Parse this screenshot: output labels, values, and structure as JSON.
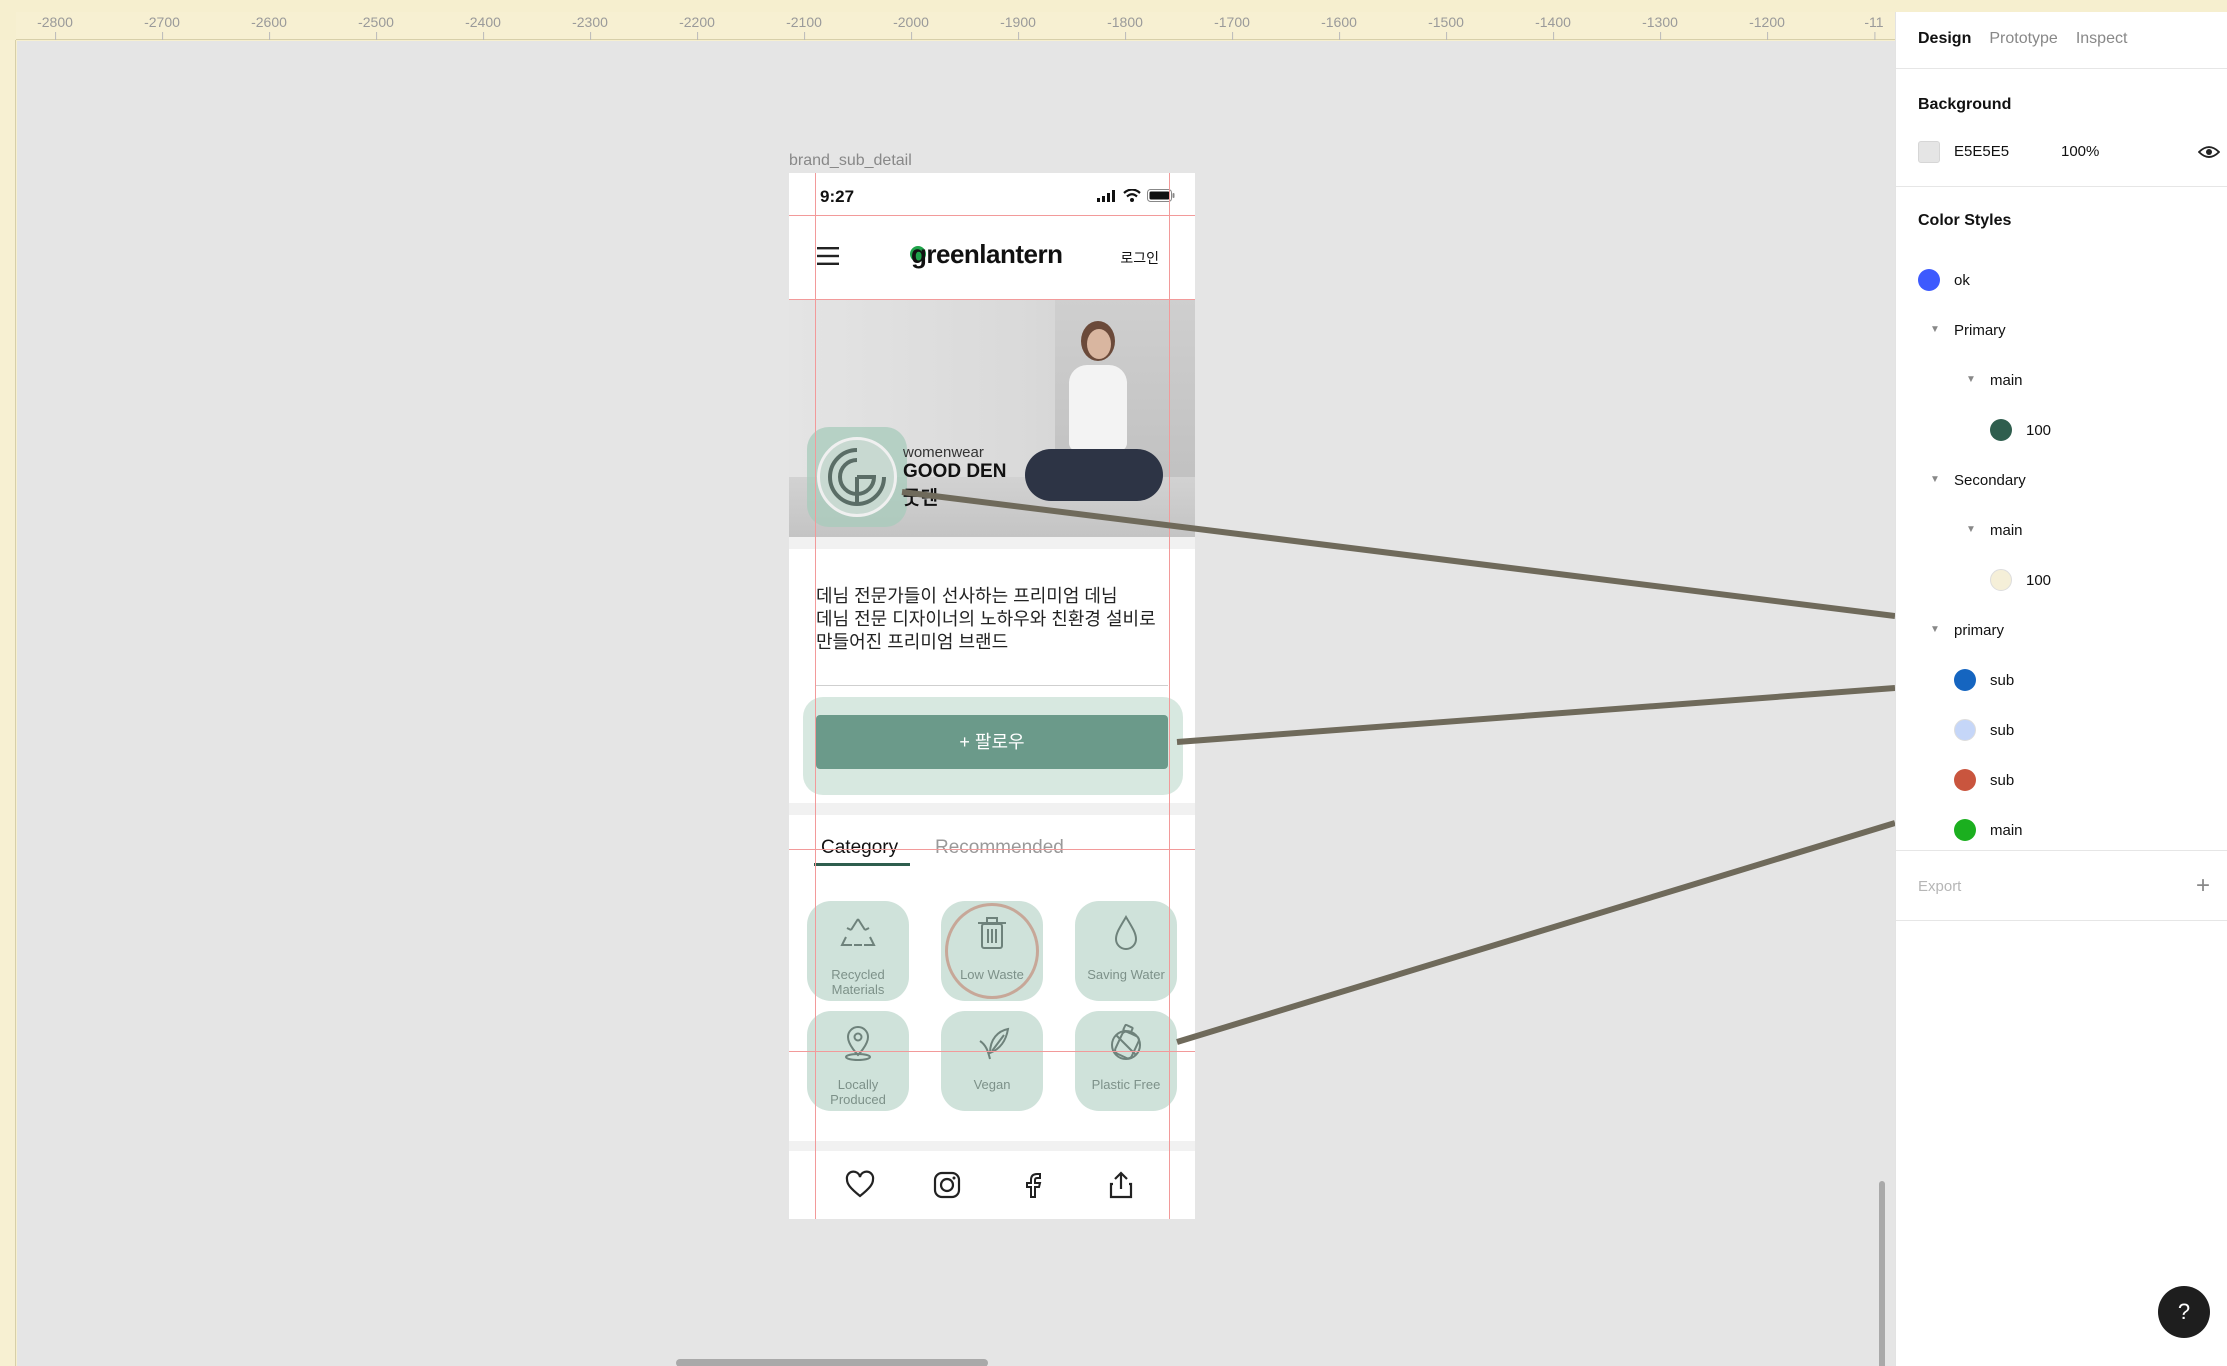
{
  "ruler": {
    "ticks": [
      "-2800",
      "-2700",
      "-2600",
      "-2500",
      "-2400",
      "-2300",
      "-2200",
      "-2100",
      "-2000",
      "-1900",
      "-1800",
      "-1700",
      "-1600",
      "-1500",
      "-1400",
      "-1300",
      "-1200",
      "-11"
    ]
  },
  "canvas": {
    "frame_label": "brand_sub_detail",
    "background": "#E5E5E5"
  },
  "phone": {
    "status_time": "9:27",
    "logo": "greenlantern",
    "login": "로그인",
    "brand": {
      "type": "womenwear",
      "name_en": "GOOD DEN",
      "name_ko": "굿덴"
    },
    "description": "데님 전문가들이 선사하는 프리미엄 데님\n데님  전문 디자이너의 노하우와 친환경 설비로\n만들어진 프리미엄 브랜드",
    "follow_label": "+ 팔로우",
    "tabs": [
      "Category",
      "Recommended"
    ],
    "categories": [
      {
        "label": "Recycled\nMaterials",
        "icon": "recycle-icon"
      },
      {
        "label": "Low Waste",
        "icon": "trash-icon"
      },
      {
        "label": "Saving Water",
        "icon": "water-drop-icon"
      },
      {
        "label": "Locally\nProduced",
        "icon": "location-pin-icon"
      },
      {
        "label": "Vegan",
        "icon": "leaf-icon"
      },
      {
        "label": "Plastic Free",
        "icon": "plastic-free-icon"
      }
    ],
    "bottom_nav": [
      "heart-icon",
      "instagram-icon",
      "facebook-icon",
      "share-icon"
    ],
    "colors": {
      "accent_green": "#6B9A8A",
      "badge_overlay": "#A7CBBB",
      "tab_underline": "#2F5E4E",
      "guide_lines": "#F29A9A"
    }
  },
  "panel": {
    "tabs": [
      "Design",
      "Prototype",
      "Inspect"
    ],
    "active_tab": "Design",
    "background": {
      "title": "Background",
      "hex": "E5E5E5",
      "opacity": "100%"
    },
    "color_styles": {
      "title": "Color Styles",
      "items": [
        {
          "label": "ok",
          "color": "#3D5AFE",
          "kind": "swatch"
        },
        {
          "label": "Primary",
          "kind": "group"
        },
        {
          "label": "main",
          "kind": "subgroup"
        },
        {
          "label": "100",
          "color": "#2F5E4E",
          "kind": "swatch"
        },
        {
          "label": "Secondary",
          "kind": "group"
        },
        {
          "label": "main",
          "kind": "subgroup"
        },
        {
          "label": "100",
          "color": "#F5EFD8",
          "kind": "swatch"
        },
        {
          "label": "primary",
          "kind": "group"
        },
        {
          "label": "sub",
          "color": "#1565C0",
          "kind": "swatch"
        },
        {
          "label": "sub",
          "color": "#C5D6F8",
          "kind": "swatch"
        },
        {
          "label": "sub",
          "color": "#C9553E",
          "kind": "swatch"
        },
        {
          "label": "main",
          "color": "#1BAF1F",
          "kind": "swatch"
        }
      ]
    },
    "export_label": "Export",
    "help_label": "?"
  }
}
